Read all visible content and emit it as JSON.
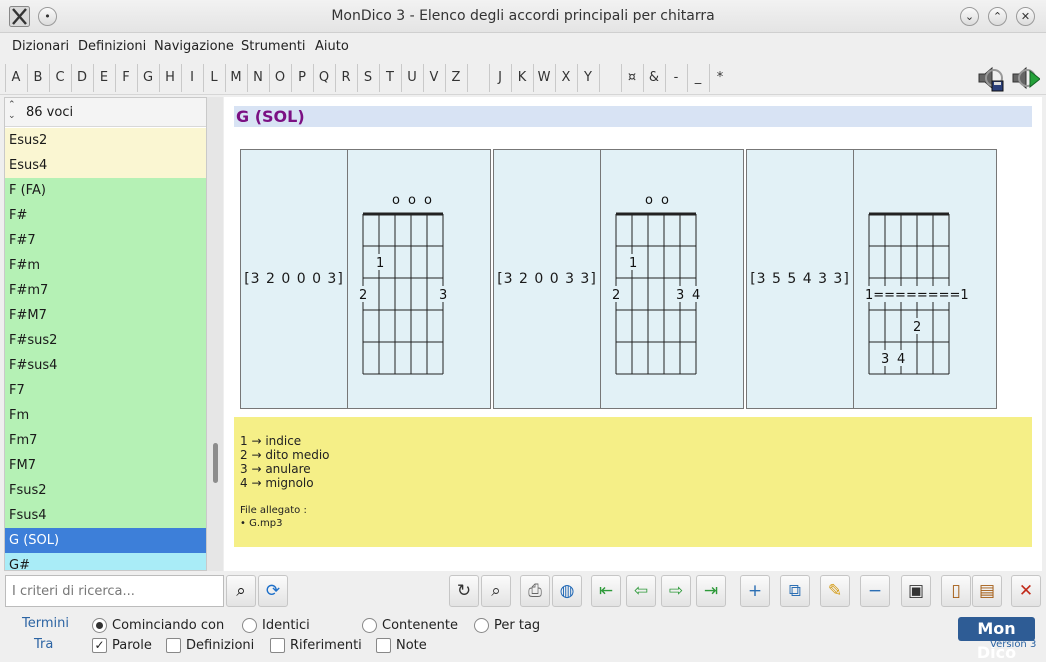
{
  "window": {
    "title": "MonDico 3 - Elenco degli accordi principali per chitarra",
    "buttons": [
      "minimize",
      "maximize",
      "close"
    ]
  },
  "menu": [
    "Dizionari",
    "Definizioni",
    "Navigazione",
    "Strumenti",
    "Aiuto"
  ],
  "letters": [
    "A",
    "B",
    "C",
    "D",
    "E",
    "F",
    "G",
    "H",
    "I",
    "L",
    "M",
    "N",
    "O",
    "P",
    "Q",
    "R",
    "S",
    "T",
    "U",
    "V",
    "Z",
    "",
    "J",
    "K",
    "W",
    "X",
    "Y",
    "",
    "¤",
    "&",
    "-",
    "_",
    "*"
  ],
  "list": {
    "count_label": "86 voci",
    "items": [
      {
        "label": "Esus2",
        "color": "#faf6d2"
      },
      {
        "label": "Esus4",
        "color": "#faf6d2"
      },
      {
        "label": "F (FA)",
        "color": "#b5f1b5"
      },
      {
        "label": "F#",
        "color": "#b5f1b5"
      },
      {
        "label": "F#7",
        "color": "#b5f1b5"
      },
      {
        "label": "F#m",
        "color": "#b5f1b5"
      },
      {
        "label": "F#m7",
        "color": "#b5f1b5"
      },
      {
        "label": "F#M7",
        "color": "#b5f1b5"
      },
      {
        "label": "F#sus2",
        "color": "#b5f1b5"
      },
      {
        "label": "F#sus4",
        "color": "#b5f1b5"
      },
      {
        "label": "F7",
        "color": "#b5f1b5"
      },
      {
        "label": "Fm",
        "color": "#b5f1b5"
      },
      {
        "label": "Fm7",
        "color": "#b5f1b5"
      },
      {
        "label": "FM7",
        "color": "#b5f1b5"
      },
      {
        "label": "Fsus2",
        "color": "#b5f1b5"
      },
      {
        "label": "Fsus4",
        "color": "#b5f1b5"
      },
      {
        "label": "G (SOL)",
        "color": "#3d7fd9",
        "selected": true
      },
      {
        "label": "G#",
        "color": "#a9ecf7"
      }
    ]
  },
  "entry": {
    "title": "G (SOL)",
    "chords": [
      {
        "code": "[3 2 0 0 0 3]"
      },
      {
        "code": "[3 2 0 0 3 3]"
      },
      {
        "code": "[3 5 5 4 3 3]"
      }
    ],
    "legend": [
      "1 → indice",
      "2 → dito medio",
      "3 → anulare",
      "4 → mignolo"
    ],
    "file_label": "File allegato :",
    "file_name": "• G.mp3"
  },
  "search": {
    "placeholder": "I criteri di ricerca..."
  },
  "options": {
    "termini_label": "Termini",
    "tra_label": "Tra",
    "match_modes": [
      {
        "label": "Cominciando con",
        "selected": true
      },
      {
        "label": "Identici",
        "selected": false
      },
      {
        "label": "Contenente",
        "selected": false
      },
      {
        "label": "Per tag",
        "selected": false
      }
    ],
    "fields": [
      {
        "label": "Parole",
        "checked": true
      },
      {
        "label": "Definizioni",
        "checked": false
      },
      {
        "label": "Riferimenti",
        "checked": false
      },
      {
        "label": "Note",
        "checked": false
      }
    ]
  },
  "brand": {
    "logo": "Mon Dico",
    "version": "Version 3"
  }
}
